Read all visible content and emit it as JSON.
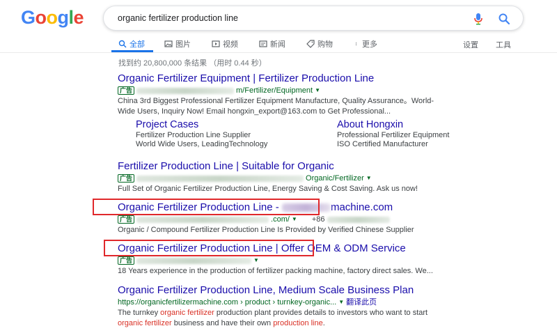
{
  "logo": [
    "G",
    "o",
    "o",
    "g",
    "l",
    "e"
  ],
  "logo_colors": [
    "#4285F4",
    "#EA4335",
    "#FBBC05",
    "#4285F4",
    "#34A853",
    "#EA4335"
  ],
  "search": {
    "query": "organic fertilizer production line"
  },
  "tabs": [
    {
      "label": "全部",
      "icon": "search-icon"
    },
    {
      "label": "图片",
      "icon": "image-icon"
    },
    {
      "label": "视频",
      "icon": "video-icon"
    },
    {
      "label": "新闻",
      "icon": "news-icon"
    },
    {
      "label": "购物",
      "icon": "tag-icon"
    },
    {
      "label": "更多",
      "icon": "more-icon"
    }
  ],
  "tools": {
    "settings": "设置",
    "tools": "工具"
  },
  "stats": "找到约 20,800,000 条结果 （用时 0.44 秒）",
  "ad_label": "广告",
  "results": [
    {
      "title": "Organic Fertilizer Equipment | Fertilizer Production Line",
      "url_tail": "m/Fertilizer/Equipment",
      "snippet_1": "China 3rd Biggest Professional Fertilizer Equipment Manufacture, Quality Assurance。World-",
      "snippet_2": "Wide Users, Inquiry Now! Email hongxin_export@163.com to Get Professional..."
    },
    {
      "title": "Fertilizer Production Line | Suitable for Organic",
      "url_tail": "Organic/Fertilizer",
      "snippet_1": "Full Set of Organic Fertilizer Production Line, Energy Saving & Cost Saving. Ask us now!"
    },
    {
      "title_a": "Organic Fertilizer Production Line",
      "title_b": " - ",
      "title_c": "machine.com",
      "url_tail": ".com/",
      "phone": "+86",
      "snippet_1": "Organic / Compound Fertilizer Production Line Is Provided by Verified Chinese Supplier"
    },
    {
      "title_a": "Organic Fertilizer Production Line",
      "title_b": "| Offer OEM & ODM Service",
      "snippet_1": "18 Years experience in the production of fertilizer packing machine, factory direct sales. We..."
    },
    {
      "title": "Organic Fertilizer Production Line, Medium Scale Business Plan",
      "url": "https://organicfertilizermachine.com › product › turnkey-organic...",
      "translate": "翻译此页",
      "snippet_1a": "The turnkey ",
      "snippet_1b": "organic fertilizer",
      "snippet_1c": " production plant provides details to investors who want to start",
      "snippet_2a": "organic fertilizer",
      "snippet_2b": " business and have their own ",
      "snippet_2c": "production line",
      "snippet_2d": "."
    }
  ],
  "sitelinks": [
    {
      "title": "Project Cases",
      "line_1": "Fertilizer Production Line Supplier",
      "line_2": "World Wide Users, LeadingTechnology"
    },
    {
      "title": "About Hongxin",
      "line_1": "Professional Fertilizer Equipment",
      "line_2": "ISO Certified Manufacturer"
    }
  ]
}
